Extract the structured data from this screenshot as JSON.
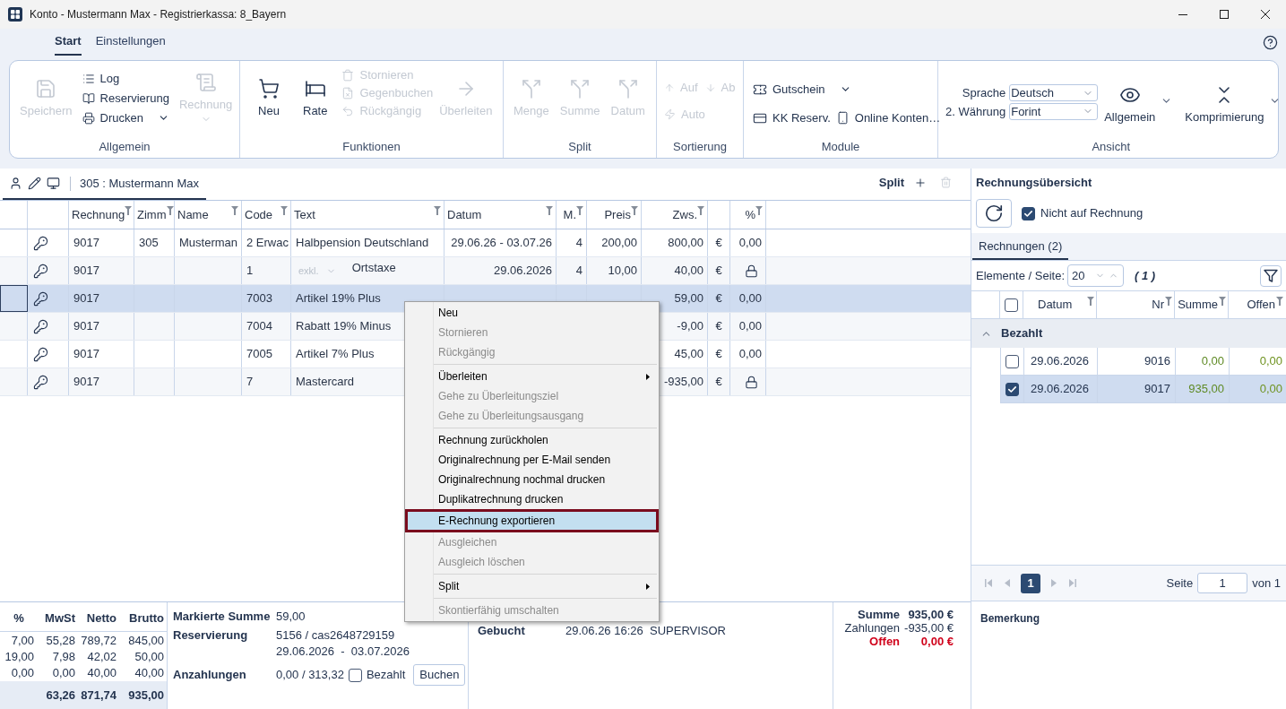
{
  "window": {
    "title": "Konto - Mustermann Max - Registrierkassa: 8_Bayern"
  },
  "ribbon": {
    "tabs": [
      {
        "label": "Start",
        "selected": true
      },
      {
        "label": "Einstellungen",
        "selected": false
      }
    ],
    "groups": [
      {
        "label": "Allgemein",
        "buttons": [
          {
            "label": "Speichern",
            "disabled": true,
            "dropdown": false
          },
          {
            "label": "Log",
            "disabled": false,
            "dropdown": false
          },
          {
            "label": "Reservierung",
            "disabled": false,
            "dropdown": false
          },
          {
            "label": "Drucken",
            "disabled": false,
            "dropdown": true
          },
          {
            "label": "Rechnung",
            "disabled": true,
            "dropdown": true
          }
        ]
      },
      {
        "label": "Funktionen",
        "buttons": [
          {
            "label": "Neu",
            "disabled": false,
            "dropdown": false
          },
          {
            "label": "Rate",
            "disabled": false,
            "dropdown": false
          },
          {
            "label": "Stornieren",
            "disabled": true,
            "dropdown": false
          },
          {
            "label": "Gegenbuchen",
            "disabled": true,
            "dropdown": false
          },
          {
            "label": "Rückgängig",
            "disabled": true,
            "dropdown": false
          },
          {
            "label": "Überleiten",
            "disabled": true,
            "dropdown": false
          }
        ]
      },
      {
        "label": "Split",
        "buttons": [
          {
            "label": "Menge",
            "disabled": true,
            "dropdown": false
          },
          {
            "label": "Summe",
            "disabled": true,
            "dropdown": false
          },
          {
            "label": "Datum",
            "disabled": true,
            "dropdown": false
          }
        ]
      },
      {
        "label": "Sortierung",
        "buttons": [
          {
            "label": "Auf",
            "disabled": true,
            "dropdown": false
          },
          {
            "label": "Ab",
            "disabled": true,
            "dropdown": false
          },
          {
            "label": "Auto",
            "disabled": true,
            "dropdown": false
          }
        ]
      },
      {
        "label": "Module",
        "buttons": [
          {
            "label": "Gutschein",
            "disabled": false,
            "dropdown": true
          },
          {
            "label": "KK Reserv.",
            "disabled": false,
            "dropdown": false
          },
          {
            "label": "Online Konten…",
            "disabled": false,
            "dropdown": false
          }
        ]
      },
      {
        "label": "Ansicht",
        "fields": [
          {
            "label": "Sprache",
            "value": "Deutsch"
          },
          {
            "label": "2. Währung",
            "value": "Forint"
          }
        ],
        "buttons": [
          {
            "label": "Allgemein",
            "disabled": false,
            "dropdown": true
          },
          {
            "label": "Komprimierung",
            "disabled": false,
            "dropdown": true
          }
        ]
      }
    ]
  },
  "record_toolbar": {
    "tab": {
      "label": "305 : Mustermann Max",
      "selected": true
    },
    "split_label": "Split"
  },
  "bookings": {
    "columns": [
      "Rechnung",
      "Zimm",
      "Name",
      "Code",
      "Text",
      "Datum",
      "M.",
      "Preis",
      "Zws.",
      "%"
    ],
    "rows": [
      {
        "rechnung": "9017",
        "zimmer": "305",
        "name": "Musterman",
        "code": "2 Erwac",
        "text": "Halbpension Deutschland",
        "datum": "29.06.26 - 03.07.26",
        "menge": "4",
        "preis": "200,00",
        "zws": "800,00",
        "currency": "€",
        "percent": "0,00",
        "locked": false,
        "selected": false
      },
      {
        "rechnung": "9017",
        "code": "1",
        "inline_select": "exkl.",
        "text": "Ortstaxe",
        "datum": "29.06.2026",
        "menge": "4",
        "preis": "10,00",
        "zws": "40,00",
        "currency": "€",
        "locked": true,
        "selected": false
      },
      {
        "rechnung": "9017",
        "code": "7003",
        "text": "Artikel 19% Plus",
        "zws": "59,00",
        "currency": "€",
        "percent": "0,00",
        "locked": false,
        "selected": true
      },
      {
        "rechnung": "9017",
        "code": "7004",
        "text": "Rabatt 19% Minus",
        "zws": "-9,00",
        "currency": "€",
        "percent": "0,00",
        "locked": false,
        "selected": false
      },
      {
        "rechnung": "9017",
        "code": "7005",
        "text": "Artikel 7% Plus",
        "zws": "45,00",
        "currency": "€",
        "percent": "0,00",
        "locked": false,
        "selected": false
      },
      {
        "rechnung": "9017",
        "code": "7",
        "text": "Mastercard",
        "zws": "-935,00",
        "currency": "€",
        "locked": true,
        "selected": false
      }
    ]
  },
  "invoice_overview": {
    "title": "Rechnungsübersicht",
    "not_on_invoice": {
      "label": "Nicht auf Rechnung",
      "checked": true
    },
    "tabs": [
      {
        "label": "Rechnungen (2)",
        "selected": true
      }
    ],
    "page_size_label": "Elemente / Seite:",
    "page_size": "20",
    "page_count": "( 1 )",
    "select_all": {
      "checked": false
    },
    "columns": [
      "Datum",
      "Nr",
      "Summe",
      "Offen"
    ],
    "group": {
      "label": "Bezahlt",
      "expanded": true
    },
    "rows": [
      {
        "datum": "29.06.2026",
        "nr": "9016",
        "summe": "0,00",
        "offen": "0,00",
        "checked": false,
        "selected": false
      },
      {
        "datum": "29.06.2026",
        "nr": "9017",
        "summe": "935,00",
        "offen": "0,00",
        "checked": true,
        "selected": true
      }
    ],
    "pagination": {
      "pages": [
        {
          "label": "1",
          "selected": true
        }
      ],
      "page_label": "Seite",
      "page_value": "1",
      "of_label": "von 1"
    },
    "remark_label": "Bemerkung"
  },
  "tax_summary": {
    "columns": [
      "%",
      "MwSt",
      "Netto",
      "Brutto"
    ],
    "rows": [
      [
        "7,00",
        "55,28",
        "789,72",
        "845,00"
      ],
      [
        "19,00",
        "7,98",
        "42,02",
        "50,00"
      ],
      [
        "0,00",
        "0,00",
        "40,00",
        "40,00"
      ]
    ],
    "totals": [
      "63,26",
      "871,74",
      "935,00"
    ]
  },
  "details": {
    "marked_sum": {
      "label": "Markierte Summe",
      "value": "59,00"
    },
    "reservation": {
      "label": "Reservierung",
      "lines": [
        "5156 / cas2648729159",
        "29.06.2026  -  03.07.2026"
      ]
    },
    "deposits": {
      "label": "Anzahlungen",
      "value": "0,00 / 313,32",
      "paid": {
        "label": "Bezahlt",
        "checked": false
      },
      "button": "Buchen"
    }
  },
  "booking_info": [
    {
      "label": "Gebucht",
      "date": "29.06.26 16:26",
      "user": "SUPERVISOR"
    }
  ],
  "totals": [
    {
      "kind": "total",
      "label": "Summe",
      "value": "935,00 €"
    },
    {
      "kind": "payment",
      "label": "Zahlungen",
      "value": "-935,00 €"
    },
    {
      "kind": "open",
      "label": "Offen",
      "value": "0,00 €"
    }
  ],
  "context_menu": {
    "sections": [
      {
        "items": [
          {
            "label": "Neu",
            "disabled": false,
            "submenu": false,
            "selected": false
          },
          {
            "label": "Stornieren",
            "disabled": true,
            "submenu": false,
            "selected": false
          },
          {
            "label": "Rückgängig",
            "disabled": true,
            "submenu": false,
            "selected": false
          }
        ]
      },
      {
        "items": [
          {
            "label": "Überleiten",
            "disabled": false,
            "submenu": true,
            "selected": false
          },
          {
            "label": "Gehe zu Überleitungsziel",
            "disabled": true,
            "submenu": false,
            "selected": false
          },
          {
            "label": "Gehe zu Überleitungsausgang",
            "disabled": true,
            "submenu": false,
            "selected": false
          }
        ]
      },
      {
        "items": [
          {
            "label": "Rechnung zurückholen",
            "disabled": false,
            "submenu": false,
            "selected": false
          },
          {
            "label": "Originalrechnung per E-Mail senden",
            "disabled": false,
            "submenu": false,
            "selected": false
          },
          {
            "label": "Originalrechnung nochmal drucken",
            "disabled": false,
            "submenu": false,
            "selected": false
          },
          {
            "label": "Duplikatrechnung drucken",
            "disabled": false,
            "submenu": false,
            "selected": false
          },
          {
            "label": "E-Rechnung exportieren",
            "disabled": false,
            "submenu": false,
            "selected": true
          },
          {
            "label": "Ausgleichen",
            "disabled": true,
            "submenu": false,
            "selected": false
          },
          {
            "label": "Ausgleich löschen",
            "disabled": true,
            "submenu": false,
            "selected": false
          }
        ]
      },
      {
        "items": [
          {
            "label": "Split",
            "disabled": false,
            "submenu": true,
            "selected": false
          }
        ]
      },
      {
        "items": [
          {
            "label": "Skontierfähig umschalten",
            "disabled": true,
            "submenu": false,
            "selected": false
          }
        ]
      }
    ]
  }
}
